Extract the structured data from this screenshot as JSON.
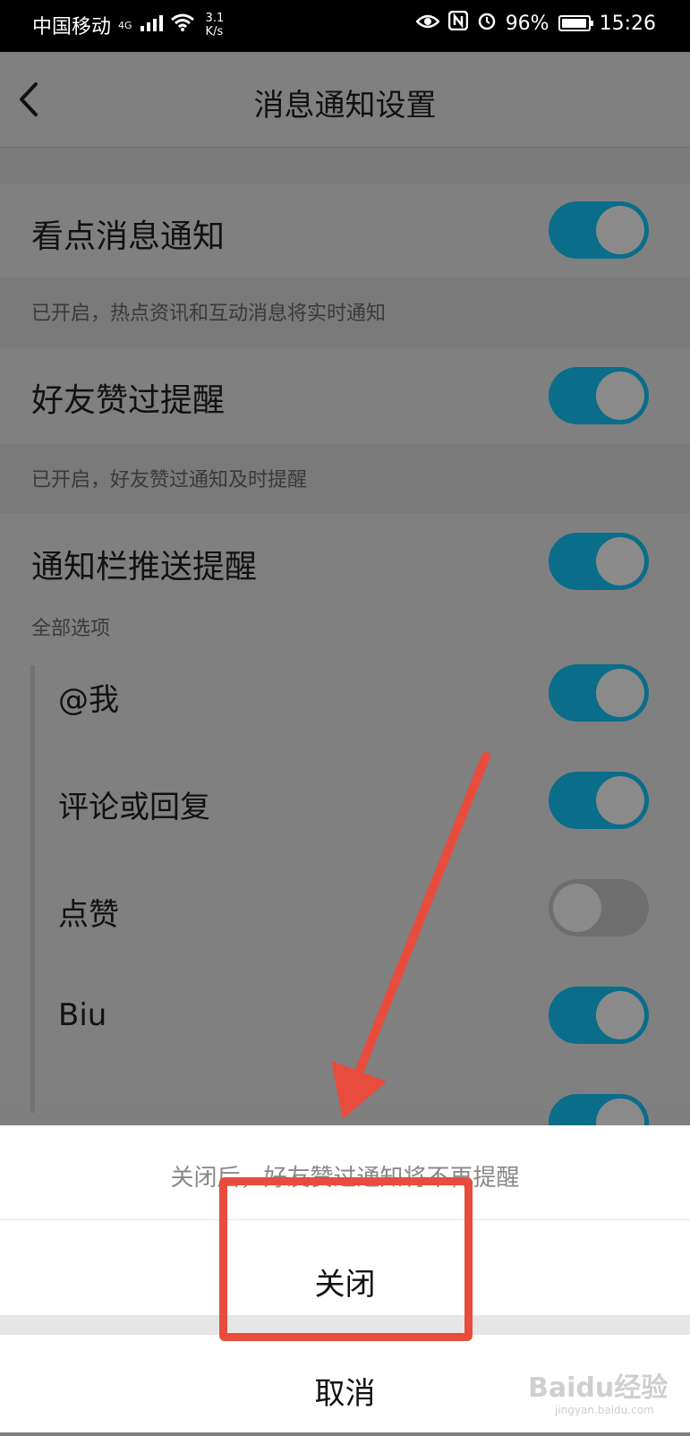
{
  "status_bar": {
    "carrier": "中国移动",
    "network": "4G",
    "speed": "3.1\nK/s",
    "battery": "96%",
    "time": "15:26"
  },
  "header": {
    "title": "消息通知设置"
  },
  "settings": {
    "kandian": {
      "label": "看点消息通知",
      "note": "已开启，热点资讯和互动消息将实时通知",
      "on": true
    },
    "friend_like": {
      "label": "好友赞过提醒",
      "note": "已开启，好友赞过通知及时提醒",
      "on": true
    },
    "notify_bar": {
      "label": "通知栏推送提醒",
      "note": "全部选项",
      "on": true
    },
    "sub_items": [
      {
        "label": "@我",
        "on": true
      },
      {
        "label": "评论或回复",
        "on": true
      },
      {
        "label": "点赞",
        "on": false
      },
      {
        "label": "Biu",
        "on": true
      }
    ]
  },
  "sheet": {
    "message": "关闭后，好友赞过通知将不再提醒",
    "confirm": "关闭",
    "cancel": "取消"
  },
  "watermark": {
    "brand": "Baidu经验",
    "url": "jingyan.baidu.com"
  },
  "colors": {
    "toggle_on": "#0a6d8a",
    "annotation": "#e84c3d",
    "overlay": "#7f7f7f"
  }
}
